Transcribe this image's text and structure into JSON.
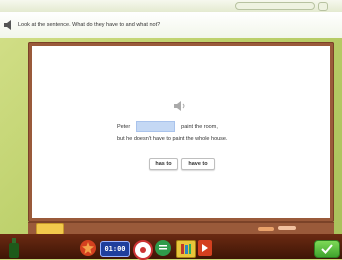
{
  "instruction": {
    "text": "Look at the sentence. What do they have to and what not?"
  },
  "exercise": {
    "line1_start": "Peter",
    "line1_end": "paint the room,",
    "line2": "but he doesn't have to paint the whole house.",
    "blank_value": ""
  },
  "options": [
    {
      "label": "has to"
    },
    {
      "label": "have to"
    }
  ],
  "toolbar": {
    "timer": "01:00"
  },
  "colors": {
    "board_frame": "#9a5a3a",
    "blank_fill": "#c4d8f4",
    "desk": "#bcd06a",
    "check_button": "#3fa42d"
  }
}
